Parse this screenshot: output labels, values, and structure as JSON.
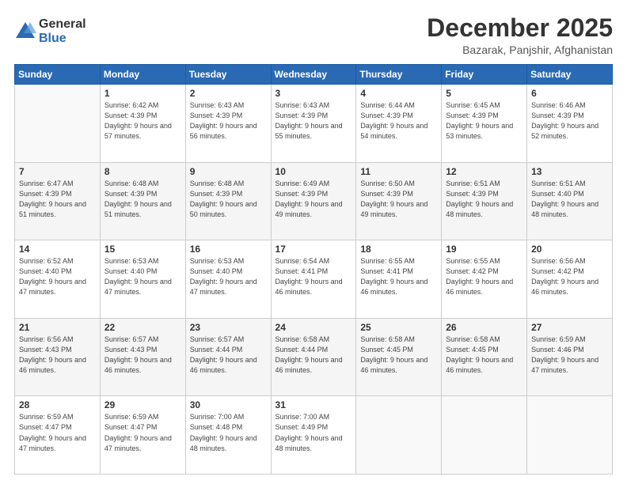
{
  "logo": {
    "general": "General",
    "blue": "Blue"
  },
  "header": {
    "title": "December 2025",
    "subtitle": "Bazarak, Panjshir, Afghanistan"
  },
  "weekdays": [
    "Sunday",
    "Monday",
    "Tuesday",
    "Wednesday",
    "Thursday",
    "Friday",
    "Saturday"
  ],
  "weeks": [
    [
      {
        "day": null,
        "info": null
      },
      {
        "day": "1",
        "sunrise": "6:42 AM",
        "sunset": "4:39 PM",
        "daylight": "9 hours and 57 minutes."
      },
      {
        "day": "2",
        "sunrise": "6:43 AM",
        "sunset": "4:39 PM",
        "daylight": "9 hours and 56 minutes."
      },
      {
        "day": "3",
        "sunrise": "6:43 AM",
        "sunset": "4:39 PM",
        "daylight": "9 hours and 55 minutes."
      },
      {
        "day": "4",
        "sunrise": "6:44 AM",
        "sunset": "4:39 PM",
        "daylight": "9 hours and 54 minutes."
      },
      {
        "day": "5",
        "sunrise": "6:45 AM",
        "sunset": "4:39 PM",
        "daylight": "9 hours and 53 minutes."
      },
      {
        "day": "6",
        "sunrise": "6:46 AM",
        "sunset": "4:39 PM",
        "daylight": "9 hours and 52 minutes."
      }
    ],
    [
      {
        "day": "7",
        "sunrise": "6:47 AM",
        "sunset": "4:39 PM",
        "daylight": "9 hours and 51 minutes."
      },
      {
        "day": "8",
        "sunrise": "6:48 AM",
        "sunset": "4:39 PM",
        "daylight": "9 hours and 51 minutes."
      },
      {
        "day": "9",
        "sunrise": "6:48 AM",
        "sunset": "4:39 PM",
        "daylight": "9 hours and 50 minutes."
      },
      {
        "day": "10",
        "sunrise": "6:49 AM",
        "sunset": "4:39 PM",
        "daylight": "9 hours and 49 minutes."
      },
      {
        "day": "11",
        "sunrise": "6:50 AM",
        "sunset": "4:39 PM",
        "daylight": "9 hours and 49 minutes."
      },
      {
        "day": "12",
        "sunrise": "6:51 AM",
        "sunset": "4:39 PM",
        "daylight": "9 hours and 48 minutes."
      },
      {
        "day": "13",
        "sunrise": "6:51 AM",
        "sunset": "4:40 PM",
        "daylight": "9 hours and 48 minutes."
      }
    ],
    [
      {
        "day": "14",
        "sunrise": "6:52 AM",
        "sunset": "4:40 PM",
        "daylight": "9 hours and 47 minutes."
      },
      {
        "day": "15",
        "sunrise": "6:53 AM",
        "sunset": "4:40 PM",
        "daylight": "9 hours and 47 minutes."
      },
      {
        "day": "16",
        "sunrise": "6:53 AM",
        "sunset": "4:40 PM",
        "daylight": "9 hours and 47 minutes."
      },
      {
        "day": "17",
        "sunrise": "6:54 AM",
        "sunset": "4:41 PM",
        "daylight": "9 hours and 46 minutes."
      },
      {
        "day": "18",
        "sunrise": "6:55 AM",
        "sunset": "4:41 PM",
        "daylight": "9 hours and 46 minutes."
      },
      {
        "day": "19",
        "sunrise": "6:55 AM",
        "sunset": "4:42 PM",
        "daylight": "9 hours and 46 minutes."
      },
      {
        "day": "20",
        "sunrise": "6:56 AM",
        "sunset": "4:42 PM",
        "daylight": "9 hours and 46 minutes."
      }
    ],
    [
      {
        "day": "21",
        "sunrise": "6:56 AM",
        "sunset": "4:43 PM",
        "daylight": "9 hours and 46 minutes."
      },
      {
        "day": "22",
        "sunrise": "6:57 AM",
        "sunset": "4:43 PM",
        "daylight": "9 hours and 46 minutes."
      },
      {
        "day": "23",
        "sunrise": "6:57 AM",
        "sunset": "4:44 PM",
        "daylight": "9 hours and 46 minutes."
      },
      {
        "day": "24",
        "sunrise": "6:58 AM",
        "sunset": "4:44 PM",
        "daylight": "9 hours and 46 minutes."
      },
      {
        "day": "25",
        "sunrise": "6:58 AM",
        "sunset": "4:45 PM",
        "daylight": "9 hours and 46 minutes."
      },
      {
        "day": "26",
        "sunrise": "6:58 AM",
        "sunset": "4:45 PM",
        "daylight": "9 hours and 46 minutes."
      },
      {
        "day": "27",
        "sunrise": "6:59 AM",
        "sunset": "4:46 PM",
        "daylight": "9 hours and 47 minutes."
      }
    ],
    [
      {
        "day": "28",
        "sunrise": "6:59 AM",
        "sunset": "4:47 PM",
        "daylight": "9 hours and 47 minutes."
      },
      {
        "day": "29",
        "sunrise": "6:59 AM",
        "sunset": "4:47 PM",
        "daylight": "9 hours and 47 minutes."
      },
      {
        "day": "30",
        "sunrise": "7:00 AM",
        "sunset": "4:48 PM",
        "daylight": "9 hours and 48 minutes."
      },
      {
        "day": "31",
        "sunrise": "7:00 AM",
        "sunset": "4:49 PM",
        "daylight": "9 hours and 48 minutes."
      },
      {
        "day": null,
        "info": null
      },
      {
        "day": null,
        "info": null
      },
      {
        "day": null,
        "info": null
      }
    ]
  ]
}
